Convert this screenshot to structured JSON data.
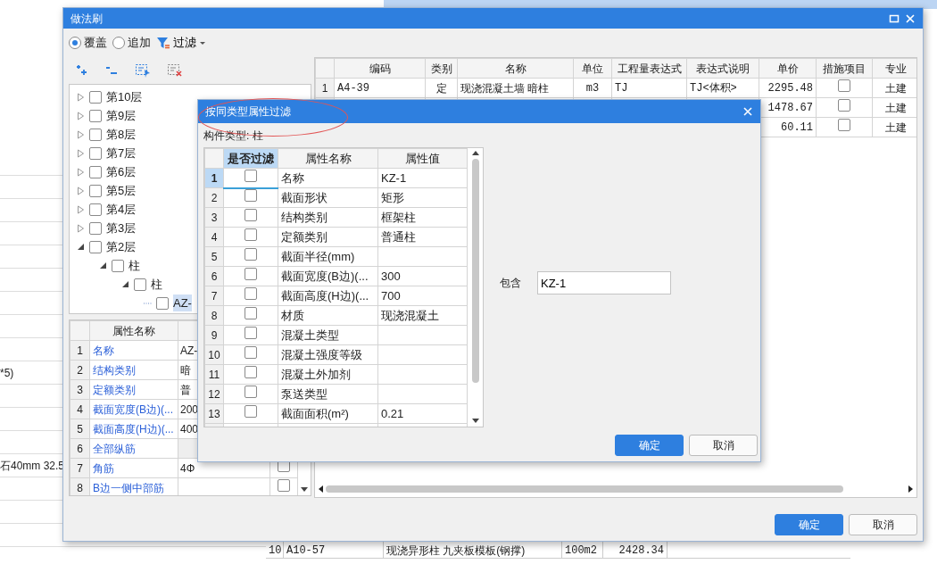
{
  "background": {
    "left_rows": [
      {
        "text": "*5)"
      },
      {
        "text": "石40mm 32.5"
      }
    ],
    "bottom_rows": [
      {
        "num": "10",
        "code": "A10-57",
        "name": "现浇异形柱 九夹板模板(钢撑)",
        "unit": "100m2",
        "price": "2428.34"
      }
    ]
  },
  "window": {
    "title": "做法刷",
    "modes": [
      {
        "label": "覆盖",
        "selected": true
      },
      {
        "label": "追加",
        "selected": false
      }
    ],
    "filter": "过滤",
    "tree": [
      {
        "label": "第10层",
        "checked": false,
        "expanded": false,
        "selected": false
      },
      {
        "label": "第9层",
        "checked": false,
        "expanded": false,
        "selected": false
      },
      {
        "label": "第8层",
        "checked": false,
        "expanded": false,
        "selected": false
      },
      {
        "label": "第7层",
        "checked": false,
        "expanded": false,
        "selected": false
      },
      {
        "label": "第6层",
        "checked": false,
        "expanded": false,
        "selected": false
      },
      {
        "label": "第5层",
        "checked": false,
        "expanded": false,
        "selected": false
      },
      {
        "label": "第4层",
        "checked": false,
        "expanded": false,
        "selected": false
      },
      {
        "label": "第3层",
        "checked": false,
        "expanded": false,
        "selected": false
      },
      {
        "label": "第2层",
        "checked": false,
        "expanded": true,
        "selected": false,
        "children": [
          {
            "label": "柱",
            "checked": false,
            "expanded": true,
            "selected": false,
            "children": [
              {
                "label": "柱",
                "checked": false,
                "expanded": true,
                "selected": false,
                "children": [
                  {
                    "label": "AZ-",
                    "checked": false,
                    "selected": true
                  }
                ]
              }
            ]
          }
        ]
      }
    ],
    "properties": {
      "header": "属性名称",
      "rows": [
        {
          "num": "1",
          "name": "名称",
          "value": "AZ-"
        },
        {
          "num": "2",
          "name": "结构类别",
          "value": "暗"
        },
        {
          "num": "3",
          "name": "定额类别",
          "value": "普"
        },
        {
          "num": "4",
          "name": "截面宽度(B边)(...",
          "value": "200"
        },
        {
          "num": "5",
          "name": "截面高度(H边)(...",
          "value": "400"
        },
        {
          "num": "6",
          "name": "全部纵筋"
        },
        {
          "num": "7",
          "name": "角筋",
          "value": "4Φ",
          "checked": false
        },
        {
          "num": "8",
          "name": "B边一侧中部筋",
          "checked": false
        }
      ]
    },
    "table": {
      "columns": [
        "编码",
        "类别",
        "名称",
        "单位",
        "工程量表达式",
        "表达式说明",
        "单价",
        "措施项目",
        "专业"
      ],
      "rows": [
        {
          "num": "1",
          "code": "A4-39",
          "type": "定",
          "name": "现浇混凝土墙  暗柱",
          "unit": "m3",
          "expr": "TJ",
          "expr_note": "TJ<体积>",
          "price": "2295.48",
          "measure": false,
          "discipline": "土建"
        },
        {
          "price": "1478.67",
          "measure": false,
          "discipline": "土建"
        },
        {
          "price": "60.11",
          "measure": false,
          "discipline": "土建"
        }
      ]
    },
    "buttons": [
      "确定",
      "取消"
    ]
  },
  "dialog": {
    "title": "按同类型属性过滤",
    "component_type": "构件类型: 柱",
    "columns": [
      "是否过滤",
      "属性名称",
      "属性值"
    ],
    "rows": [
      {
        "num": "1",
        "filter": false,
        "name": "名称",
        "value": "KZ-1",
        "selected": true
      },
      {
        "num": "2",
        "filter": false,
        "name": "截面形状",
        "value": "矩形",
        "selected": false
      },
      {
        "num": "3",
        "filter": false,
        "name": "结构类别",
        "value": "框架柱",
        "selected": false
      },
      {
        "num": "4",
        "filter": false,
        "name": "定额类别",
        "value": "普通柱",
        "selected": false
      },
      {
        "num": "5",
        "filter": false,
        "name": "截面半径(mm)",
        "selected": false
      },
      {
        "num": "6",
        "filter": false,
        "name": "截面宽度(B边)(...",
        "value": "300",
        "selected": false
      },
      {
        "num": "7",
        "filter": false,
        "name": "截面高度(H边)(...",
        "value": "700",
        "selected": false
      },
      {
        "num": "8",
        "filter": false,
        "name": "材质",
        "value": "现浇混凝土",
        "selected": false
      },
      {
        "num": "9",
        "filter": false,
        "name": "混凝土类型",
        "selected": false
      },
      {
        "num": "10",
        "filter": false,
        "name": "混凝土强度等级",
        "selected": false
      },
      {
        "num": "11",
        "filter": false,
        "name": "混凝土外加剂",
        "selected": false
      },
      {
        "num": "12",
        "filter": false,
        "name": "泵送类型",
        "selected": false
      },
      {
        "num": "13",
        "filter": false,
        "name": "截面面积(m²)",
        "value": "0.21",
        "selected": false
      }
    ],
    "contains_label": "包含",
    "contains_value": "KZ-1",
    "buttons": [
      "确定",
      "取消"
    ]
  }
}
